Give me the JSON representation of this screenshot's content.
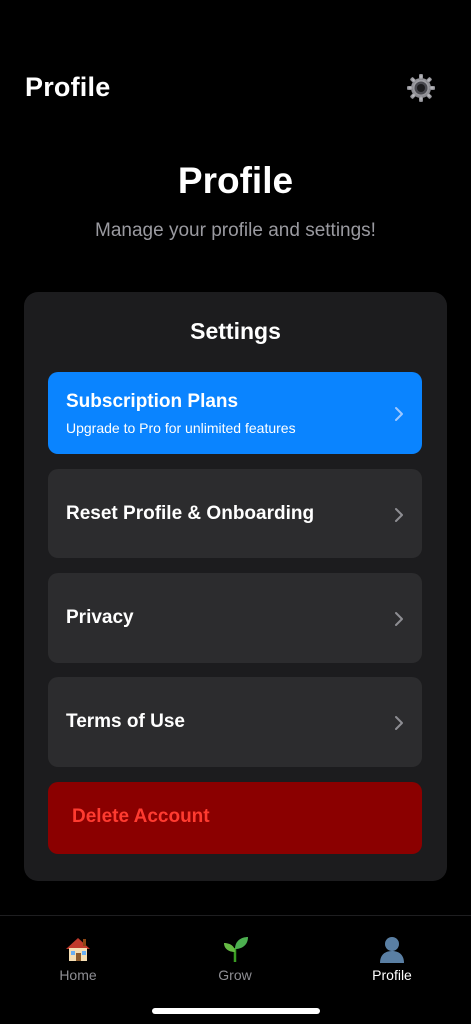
{
  "nav": {
    "title": "Profile",
    "settings_icon": "gear-icon"
  },
  "hero": {
    "title": "Profile",
    "subtitle": "Manage your profile and settings!"
  },
  "settings": {
    "title": "Settings",
    "items": [
      {
        "label": "Subscription Plans",
        "subtitle": "Upgrade to Pro for unlimited features"
      },
      {
        "label": "Reset Profile & Onboarding"
      },
      {
        "label": "Privacy"
      },
      {
        "label": "Terms of Use"
      }
    ],
    "delete_label": "Delete Account"
  },
  "tabbar": {
    "items": [
      {
        "label": "Home",
        "icon": "house-icon"
      },
      {
        "label": "Grow",
        "icon": "seedling-icon"
      },
      {
        "label": "Profile",
        "icon": "person-silhouette-icon"
      }
    ],
    "active": "Profile"
  },
  "colors": {
    "background": "#000000",
    "card": "#1c1c1e",
    "row": "#2c2c2e",
    "accent_blue": "#0a84ff",
    "danger_bg": "#8b0000",
    "danger_text": "#ff3b30"
  }
}
